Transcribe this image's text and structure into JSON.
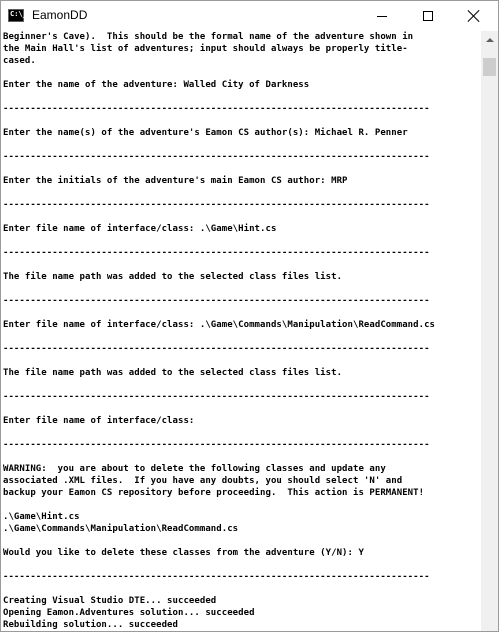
{
  "window": {
    "title": "EamonDD",
    "icon_glyph": "C:\\_",
    "icon": "console-app-icon",
    "controls": [
      "minimize-icon",
      "maximize-icon",
      "close-icon"
    ]
  },
  "console": {
    "lines": [
      "Beginner's Cave).  This should be the formal name of the adventure shown in",
      "the Main Hall's list of adventures; input should always be properly title-",
      "cased.",
      "",
      "Enter the name of the adventure: Walled City of Darkness",
      "",
      "------------------------------------------------------------------------------",
      "",
      "Enter the name(s) of the adventure's Eamon CS author(s): Michael R. Penner",
      "",
      "------------------------------------------------------------------------------",
      "",
      "Enter the initials of the adventure's main Eamon CS author: MRP",
      "",
      "------------------------------------------------------------------------------",
      "",
      "Enter file name of interface/class: .\\Game\\Hint.cs",
      "",
      "------------------------------------------------------------------------------",
      "",
      "The file name path was added to the selected class files list.",
      "",
      "------------------------------------------------------------------------------",
      "",
      "Enter file name of interface/class: .\\Game\\Commands\\Manipulation\\ReadCommand.cs",
      "",
      "------------------------------------------------------------------------------",
      "",
      "The file name path was added to the selected class files list.",
      "",
      "------------------------------------------------------------------------------",
      "",
      "Enter file name of interface/class:",
      "",
      "------------------------------------------------------------------------------",
      "",
      "WARNING:  you are about to delete the following classes and update any",
      "associated .XML files.  If you have any doubts, you should select 'N' and",
      "backup your Eamon CS repository before proceeding.  This action is PERMANENT!",
      "",
      ".\\Game\\Hint.cs",
      ".\\Game\\Commands\\Manipulation\\ReadCommand.cs",
      "",
      "Would you like to delete these classes from the adventure (Y/N): Y",
      "",
      "------------------------------------------------------------------------------",
      "",
      "Creating Visual Studio DTE... succeeded",
      "Opening Eamon.Adventures solution... succeeded",
      "Rebuilding solution... succeeded"
    ]
  },
  "colors": {
    "background": "#ffffff",
    "text": "#000000",
    "scrollbar_track": "#f0f0f0",
    "scrollbar_thumb": "#cdcdcd"
  }
}
